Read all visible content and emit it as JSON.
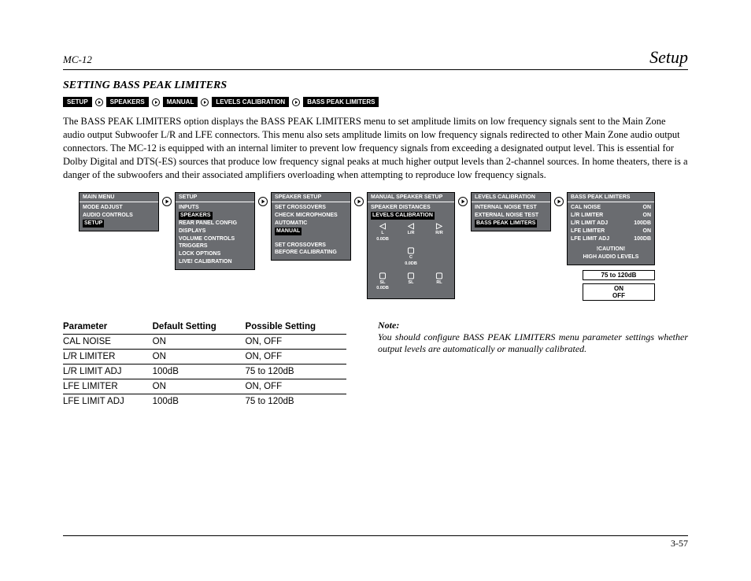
{
  "header": {
    "model": "MC-12",
    "section": "Setup"
  },
  "title": "SETTING BASS PEAK LIMITERS",
  "breadcrumb": [
    "SETUP",
    "SPEAKERS",
    "MANUAL",
    "LEVELS CALIBRATION",
    "BASS PEAK LIMITERS"
  ],
  "body": "The BASS PEAK LIMITERS option displays the BASS PEAK LIMITERS menu to set amplitude limits on low frequency signals sent to the Main Zone audio output Subwoofer L/R and LFE connectors. This menu also sets amplitude limits on low frequency signals redirected to other Main Zone audio output connectors. The MC-12 is equipped with an internal limiter to prevent low frequency signals from exceeding a designated output level. This is essential for Dolby Digital and DTS(-ES) sources that produce low frequency signal peaks at much higher output levels than 2-channel sources. In home theaters, there is a danger of the subwoofers and their associated amplifiers overloading when attempting to reproduce low frequency signals.",
  "menus": {
    "main": {
      "head": "MAIN MENU",
      "items": [
        "MODE ADJUST",
        "AUDIO CONTROLS",
        "SETUP"
      ],
      "highlight": 2
    },
    "setup": {
      "head": "SETUP",
      "items": [
        "INPUTS",
        "SPEAKERS",
        "REAR PANEL CONFIG",
        "DISPLAYS",
        "VOLUME CONTROLS",
        "TRIGGERS",
        "LOCK OPTIONS",
        "LIVE! CALIBRATION"
      ],
      "highlight": 1
    },
    "speaker": {
      "head": "SPEAKER SETUP",
      "items": [
        "SET CROSSOVERS",
        "CHECK MICROPHONES",
        "AUTOMATIC",
        "MANUAL"
      ],
      "highlight": 3,
      "footer1": "SET CROSSOVERS",
      "footer2": "BEFORE CALIBRATING"
    },
    "manual": {
      "head": "MANUAL SPEAKER SETUP",
      "items": [
        "SPEAKER DISTANCES",
        "LEVELS CALIBRATION"
      ],
      "highlight": 1,
      "speakers": [
        {
          "label": "L",
          "val": "0.0dB"
        },
        {
          "label": "L/R",
          "val": ""
        },
        {
          "label": "R/R",
          "val": ""
        },
        {
          "label": "",
          "val": ""
        },
        {
          "label": "C",
          "val": "0.0dB"
        },
        {
          "label": "",
          "val": ""
        },
        {
          "label": "SL",
          "val": "0.0dB"
        },
        {
          "label": "SL",
          "val": ""
        },
        {
          "label": "RL",
          "val": ""
        }
      ]
    },
    "levels": {
      "head": "LEVELS CALIBRATION",
      "items": [
        "INTERNAL NOISE TEST",
        "EXTERNAL NOISE TEST",
        "BASS PEAK LIMITERS"
      ],
      "highlight": 2
    },
    "bpl": {
      "head": "BASS PEAK LIMITERS",
      "rows": [
        {
          "k": "CAL NOISE",
          "v": "ON"
        },
        {
          "k": "L/R LIMITER",
          "v": "ON"
        },
        {
          "k": "L/R LIMIT ADJ",
          "v": "100dB"
        },
        {
          "k": "LFE LIMITER",
          "v": "ON"
        },
        {
          "k": "LFE LIMIT ADJ",
          "v": "100dB"
        }
      ],
      "caution1": "!CAUTION!",
      "caution2": "HIGH AUDIO LEVELS"
    },
    "out1": "75 to 120dB",
    "out2a": "ON",
    "out2b": "OFF"
  },
  "table": {
    "headers": [
      "Parameter",
      "Default Setting",
      "Possible Setting"
    ],
    "rows": [
      [
        "CAL NOISE",
        "ON",
        "ON, OFF"
      ],
      [
        "L/R LIMITER",
        "ON",
        "ON, OFF"
      ],
      [
        "L/R LIMIT ADJ",
        "100dB",
        "75 to 120dB"
      ],
      [
        "LFE LIMITER",
        "ON",
        "ON, OFF"
      ],
      [
        "LFE LIMIT ADJ",
        "100dB",
        "75 to 120dB"
      ]
    ]
  },
  "note": {
    "label": "Note:",
    "text": "You should configure BASS PEAK LIMITERS menu parameter settings whether output levels are automatically or manually calibrated."
  },
  "footer": "3-57"
}
